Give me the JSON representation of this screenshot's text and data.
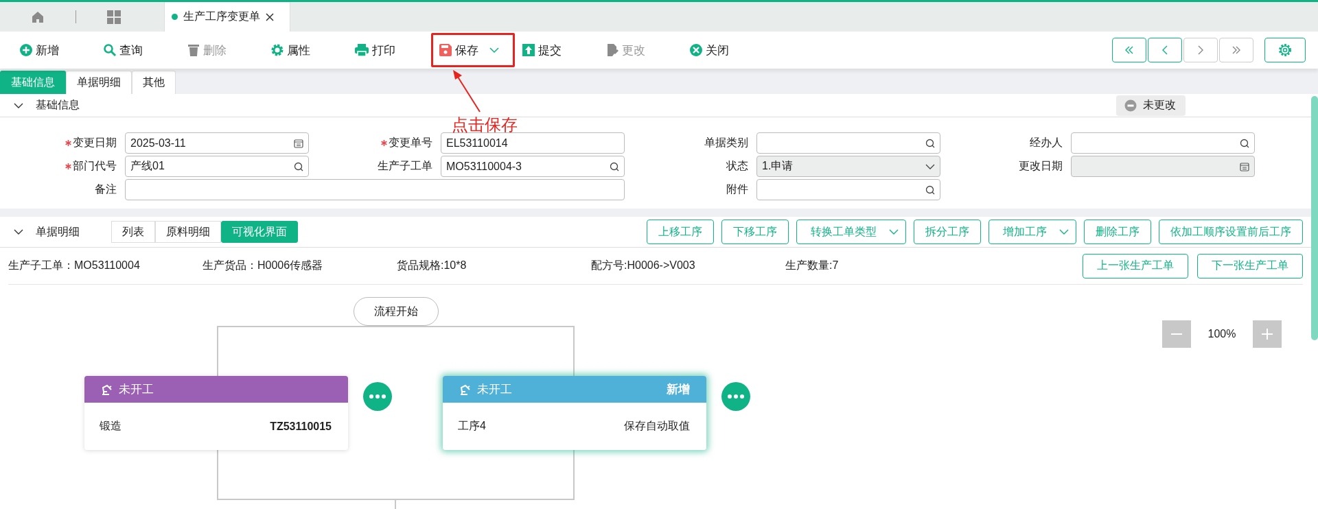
{
  "tab_bar": {
    "tabs": [
      {
        "label": "生产工序变更单",
        "selected": true
      }
    ]
  },
  "toolbar": {
    "buttons": [
      {
        "kind": "add",
        "label": "新增",
        "disabled": false,
        "highlighted": false,
        "dropdown": false
      },
      {
        "kind": "search",
        "label": "查询",
        "disabled": false,
        "highlighted": false,
        "dropdown": false
      },
      {
        "kind": "delete",
        "label": "删除",
        "disabled": true,
        "highlighted": false,
        "dropdown": false
      },
      {
        "kind": "props",
        "label": "属性",
        "disabled": false,
        "highlighted": false,
        "dropdown": false
      },
      {
        "kind": "print",
        "label": "打印",
        "disabled": false,
        "highlighted": false,
        "dropdown": false
      },
      {
        "kind": "save",
        "label": "保存",
        "disabled": false,
        "highlighted": true,
        "dropdown": true
      },
      {
        "kind": "submit",
        "label": "提交",
        "disabled": false,
        "highlighted": false,
        "dropdown": false
      },
      {
        "kind": "edit",
        "label": "更改",
        "disabled": true,
        "highlighted": false,
        "dropdown": false
      },
      {
        "kind": "close",
        "label": "关闭",
        "disabled": false,
        "highlighted": false,
        "dropdown": false
      }
    ],
    "nav_buttons": [
      {
        "kind": "first",
        "disabled": false
      },
      {
        "kind": "prev",
        "disabled": false
      },
      {
        "kind": "next",
        "disabled": true
      },
      {
        "kind": "last",
        "disabled": true
      }
    ]
  },
  "annotation": {
    "text": "点击保存"
  },
  "form_tabs": [
    {
      "label": "基础信息",
      "selected": true
    },
    {
      "label": "单据明细",
      "selected": false
    },
    {
      "label": "其他",
      "selected": false
    }
  ],
  "basic_info": {
    "title": "基础信息",
    "expanded": true,
    "status_badge": "未更改",
    "fields": [
      {
        "label": "变更日期",
        "required": true,
        "kind": "date",
        "value": "2025-03-11",
        "disabled": false,
        "wide": false
      },
      {
        "label": "变更单号",
        "required": true,
        "kind": "text",
        "value": "EL53110014",
        "disabled": false,
        "wide": false
      },
      {
        "label": "单据类别",
        "required": false,
        "kind": "search",
        "disabled": false,
        "wide": false
      },
      {
        "label": "经办人",
        "required": false,
        "kind": "search",
        "disabled": false,
        "wide": false
      },
      {
        "label": "部门代号",
        "required": true,
        "kind": "search",
        "value": "产线01",
        "disabled": false,
        "wide": false
      },
      {
        "label": "生产子工单",
        "required": false,
        "kind": "search",
        "value": "MO53110004-3",
        "disabled": false,
        "wide": false
      },
      {
        "label": "状态",
        "required": false,
        "kind": "select",
        "value": "1.申请",
        "disabled": true,
        "wide": false
      },
      {
        "label": "更改日期",
        "required": false,
        "kind": "date",
        "disabled": true,
        "wide": false
      },
      {
        "label": "备注",
        "required": false,
        "kind": "text",
        "disabled": false,
        "wide": true
      },
      {
        "label": "附件",
        "required": false,
        "kind": "search",
        "disabled": false,
        "wide": false
      }
    ]
  },
  "detail": {
    "title": "单据明细",
    "expanded": true,
    "view_tabs": [
      {
        "label": "列表",
        "selected": false
      },
      {
        "label": "原料明细",
        "selected": false
      },
      {
        "label": "可视化界面",
        "selected": true
      }
    ],
    "actions": [
      {
        "label": "上移工序",
        "dropdown": false
      },
      {
        "label": "下移工序",
        "dropdown": false
      },
      {
        "label": "转换工单类型",
        "dropdown": true
      },
      {
        "label": "拆分工序",
        "dropdown": false
      },
      {
        "label": "增加工序",
        "dropdown": true
      },
      {
        "label": "删除工序",
        "dropdown": false
      },
      {
        "label": "依加工顺序设置前后工序",
        "dropdown": false
      }
    ],
    "info": [
      "生产子工单：MO53110004",
      "生产货品：H0006传感器",
      "货品规格:10*8",
      "配方号:H0006->V003",
      "生产数量:7"
    ],
    "order_buttons": [
      "上一张生产工单",
      "下一张生产工单"
    ],
    "flow": {
      "start_label": "流程开始",
      "zoom": "100%",
      "nodes": [
        {
          "status": "未开工",
          "name": "锻造",
          "code": "TZ53110015",
          "color": "#9b5fb4",
          "highlighted": false
        },
        {
          "status": "未开工",
          "tag": "新增",
          "name": "工序4",
          "code": "保存自动取值",
          "color": "#4fb0d8",
          "highlighted": true
        }
      ]
    }
  }
}
